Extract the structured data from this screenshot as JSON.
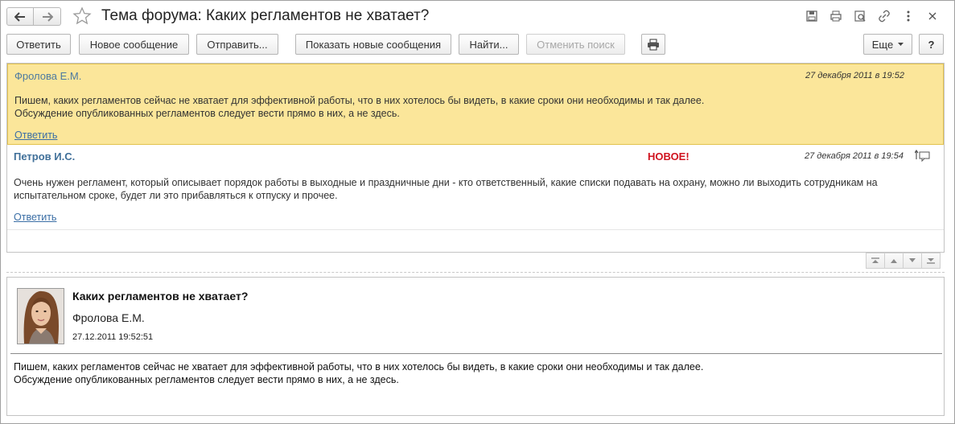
{
  "window": {
    "title": "Тема форума: Каких регламентов не хватает?"
  },
  "toolbar": {
    "reply": "Ответить",
    "new_message": "Новое сообщение",
    "send": "Отправить...",
    "show_new": "Показать новые сообщения",
    "find": "Найти...",
    "cancel_search": "Отменить поиск",
    "more": "Еще",
    "help": "?"
  },
  "messages": [
    {
      "author": "Фролова Е.М.",
      "date": "27 декабря 2011 в 19:52",
      "line1": "Пишем, каких регламентов сейчас не хватает для эффективной работы, что в них хотелось бы видеть, в какие сроки они необходимы и так далее.",
      "line2": "Обсуждение опубликованных регламентов следует вести прямо в них, а не здесь.",
      "reply": "Ответить"
    },
    {
      "author": "Петров И.С.",
      "badge": "НОВОЕ!",
      "date": "27 декабря 2011 в 19:54",
      "line1": "Очень нужен регламент, который описывает порядок работы в выходные и праздничные дни - кто ответственный, какие списки подавать на охрану, можно ли выходить сотрудникам на",
      "line2": "испытательном сроке, будет ли это прибавляться к отпуску и прочее.",
      "reply": "Ответить"
    }
  ],
  "preview": {
    "title": "Каких регламентов не хватает?",
    "author": "Фролова Е.М.",
    "date": "27.12.2011 19:52:51",
    "line1": "Пишем, каких регламентов сейчас не хватает для эффективной работы, что в них хотелось бы видеть, в какие сроки они необходимы и так далее.",
    "line2": "Обсуждение опубликованных регламентов следует вести прямо в них, а не здесь."
  },
  "colors": {
    "selected_bg": "#fbe69a",
    "link": "#3a6ea5",
    "new_badge": "#d0131f"
  }
}
